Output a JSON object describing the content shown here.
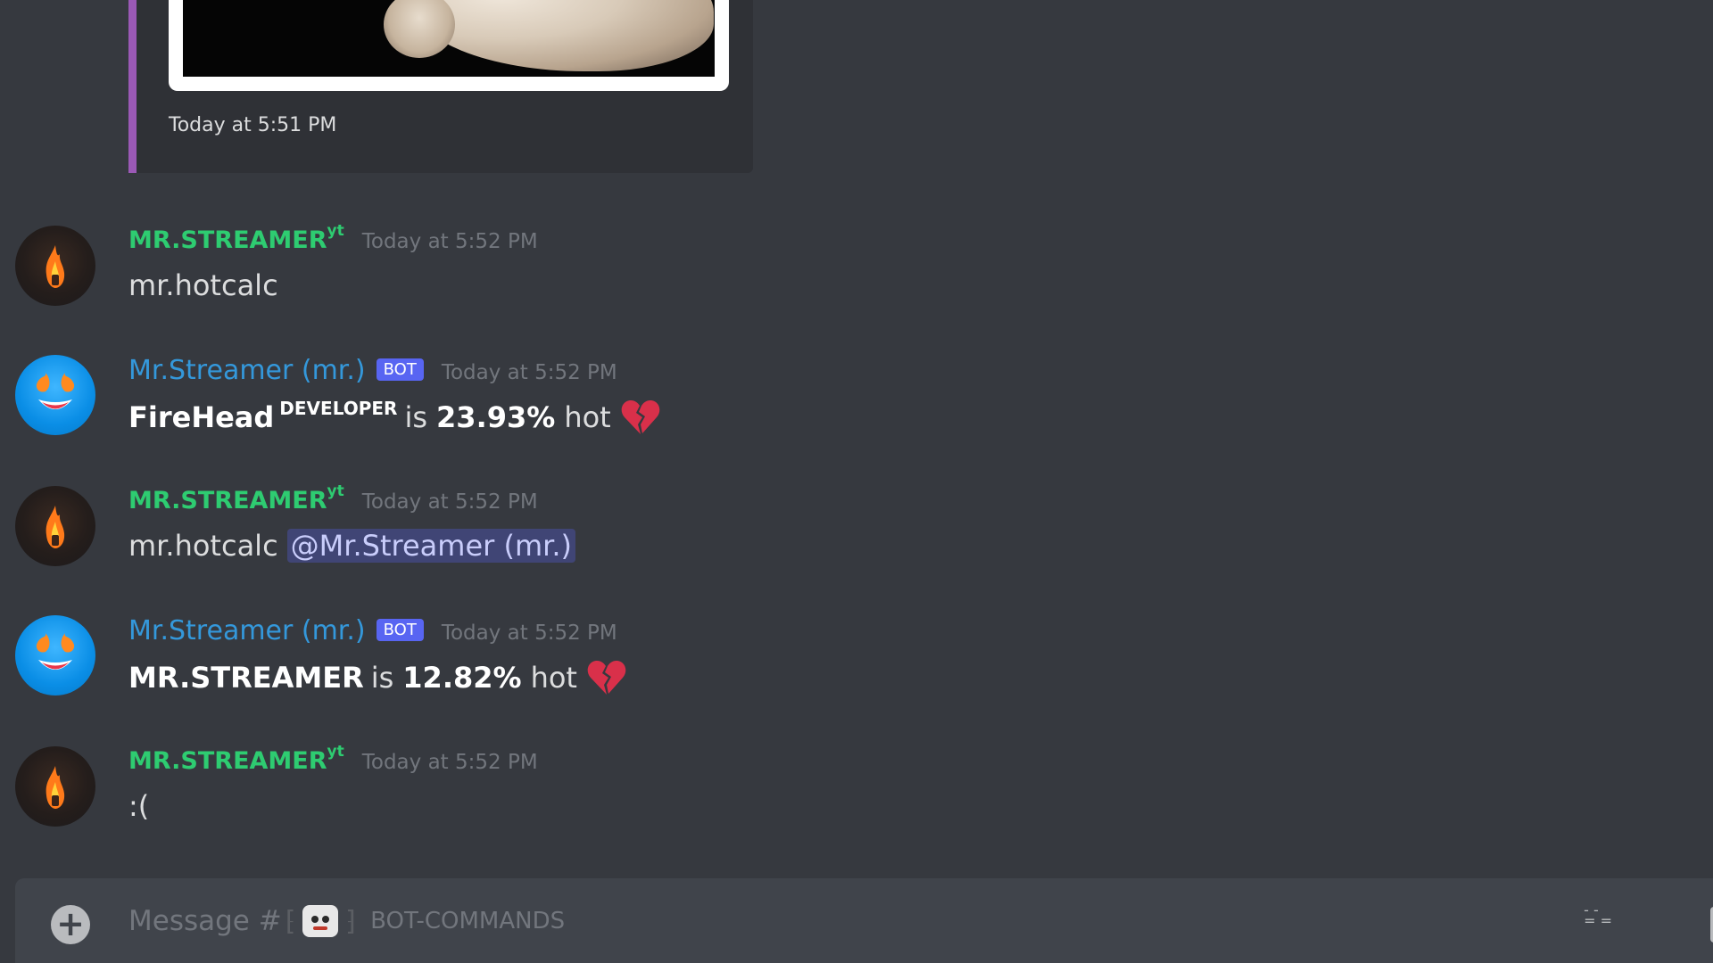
{
  "embed": {
    "timestamp": "Today at 5:51 PM"
  },
  "messages": [
    {
      "author": "MR.STREAMER",
      "author_suffix": "yt",
      "timestamp": "Today at 5:52 PM",
      "text": "mr.hotcalc"
    },
    {
      "author": "Mr.Streamer (mr.)",
      "badge": "BOT",
      "timestamp": "Today at 5:52 PM",
      "subject": "FireHead",
      "subject_suffix": "DEVELOPER",
      "is": "is",
      "percent": "23.93%",
      "hot": "hot"
    },
    {
      "author": "MR.STREAMER",
      "author_suffix": "yt",
      "timestamp": "Today at 5:52 PM",
      "text": "mr.hotcalc",
      "mention": "@Mr.Streamer (mr.)"
    },
    {
      "author": "Mr.Streamer (mr.)",
      "badge": "BOT",
      "timestamp": "Today at 5:52 PM",
      "subject": "MR.STREAMER",
      "is": "is",
      "percent": "12.82%",
      "hot": "hot"
    },
    {
      "author": "MR.STREAMER",
      "author_suffix": "yt",
      "timestamp": "Today at 5:52 PM",
      "text": ":("
    }
  ],
  "input": {
    "placeholder_prefix": "Message #",
    "channel_name": "BOT-COMMANDS"
  },
  "icons": {
    "add": "plus-circle-icon",
    "heart": "broken-heart-icon",
    "gift": "gift-icon"
  },
  "colors": {
    "background": "#36393f",
    "user_name": "#2ecc71",
    "bot_name": "#3498db",
    "bot_badge": "#5865f2",
    "embed_accent": "#9b59b6"
  }
}
